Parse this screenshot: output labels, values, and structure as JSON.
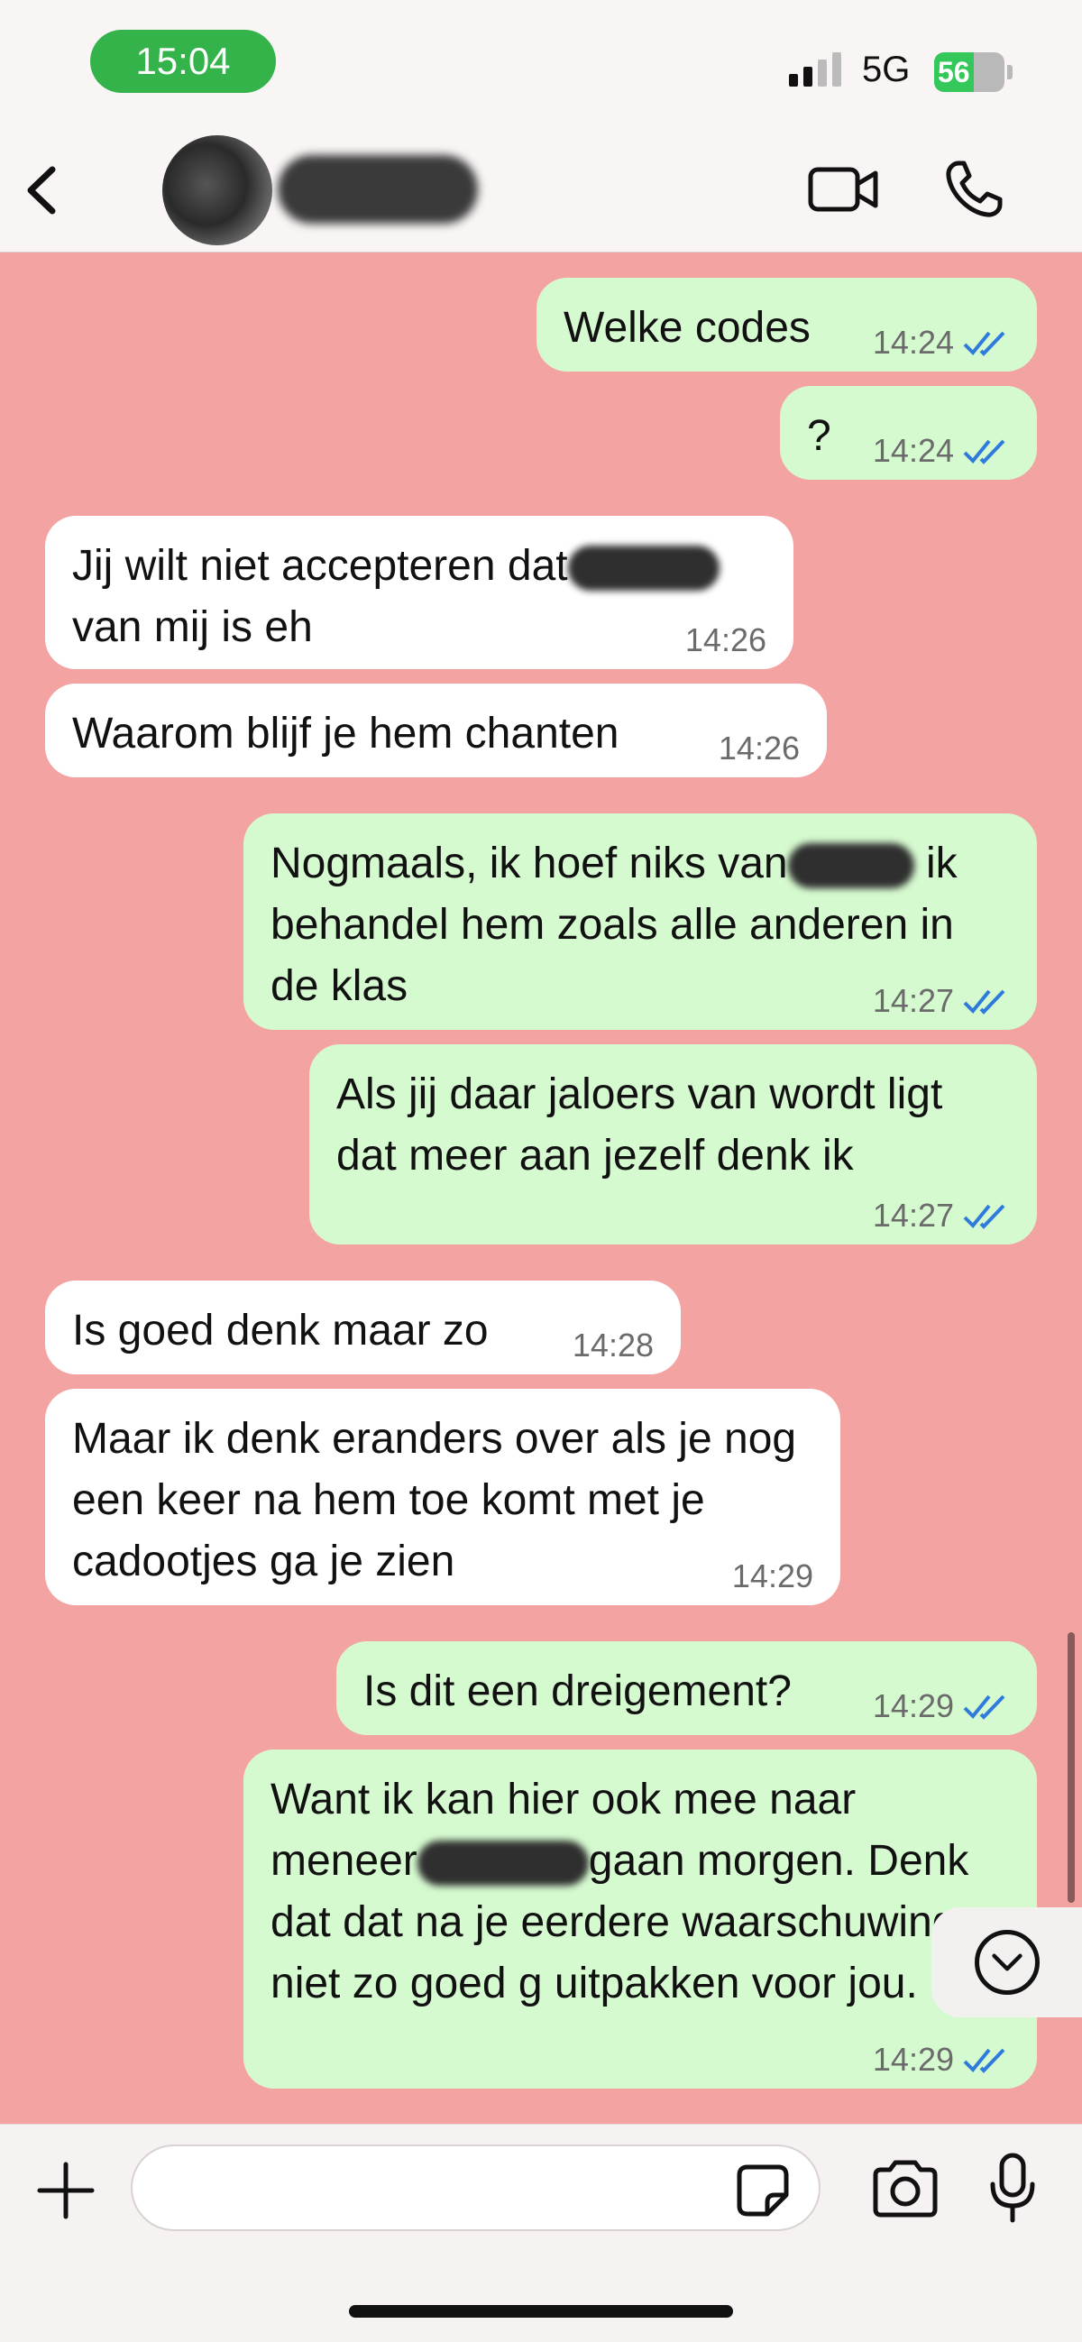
{
  "status_bar": {
    "time": "15:04",
    "network": "5G",
    "battery_level": "56",
    "battery_fraction": 0.56
  },
  "header": {
    "back_icon": "chevron-left",
    "video_icon": "video-camera",
    "call_icon": "phone"
  },
  "messages": [
    {
      "direction": "out",
      "text": "Welke codes",
      "time": "14:24",
      "status": "read"
    },
    {
      "direction": "out",
      "text": "?",
      "time": "14:24",
      "status": "read"
    },
    {
      "direction": "in",
      "text_before": "Jij wilt niet accepteren dat",
      "text_after": "van mij is eh",
      "time": "14:26"
    },
    {
      "direction": "in",
      "text": "Waarom blijf je hem chanten",
      "time": "14:26"
    },
    {
      "direction": "out",
      "text_before": "Nogmaals, ik hoef niks van",
      "text_after": "ik behandel hem zoals alle anderen in de klas",
      "time": "14:27",
      "status": "read"
    },
    {
      "direction": "out",
      "text": "Als jij daar jaloers van wordt ligt dat meer aan jezelf denk ik",
      "time": "14:27",
      "status": "read"
    },
    {
      "direction": "in",
      "text": "Is goed denk maar zo",
      "time": "14:28"
    },
    {
      "direction": "in",
      "text": "Maar ik denk eranders over als je nog een keer na hem toe komt met je cadootjes ga je zien",
      "time": "14:29"
    },
    {
      "direction": "out",
      "text": "Is dit een dreigement?",
      "time": "14:29",
      "status": "read"
    },
    {
      "direction": "out",
      "text_before": "Want ik kan hier ook mee naar meneer",
      "text_after": "gaan morgen. Denk dat dat na je eerdere waarschuwingen niet zo goed g uitpakken voor jou.",
      "time": "14:29",
      "status": "read"
    }
  ],
  "colors": {
    "chat_background": "#f4a3a3",
    "outgoing_bubble": "#d6fad0",
    "incoming_bubble": "#ffffff",
    "read_ticks": "#2f7bdc",
    "time_pill": "#34b34a"
  },
  "input": {
    "placeholder": "",
    "plus_icon": "plus",
    "sticker_icon": "sticker",
    "camera_icon": "camera",
    "mic_icon": "microphone"
  }
}
